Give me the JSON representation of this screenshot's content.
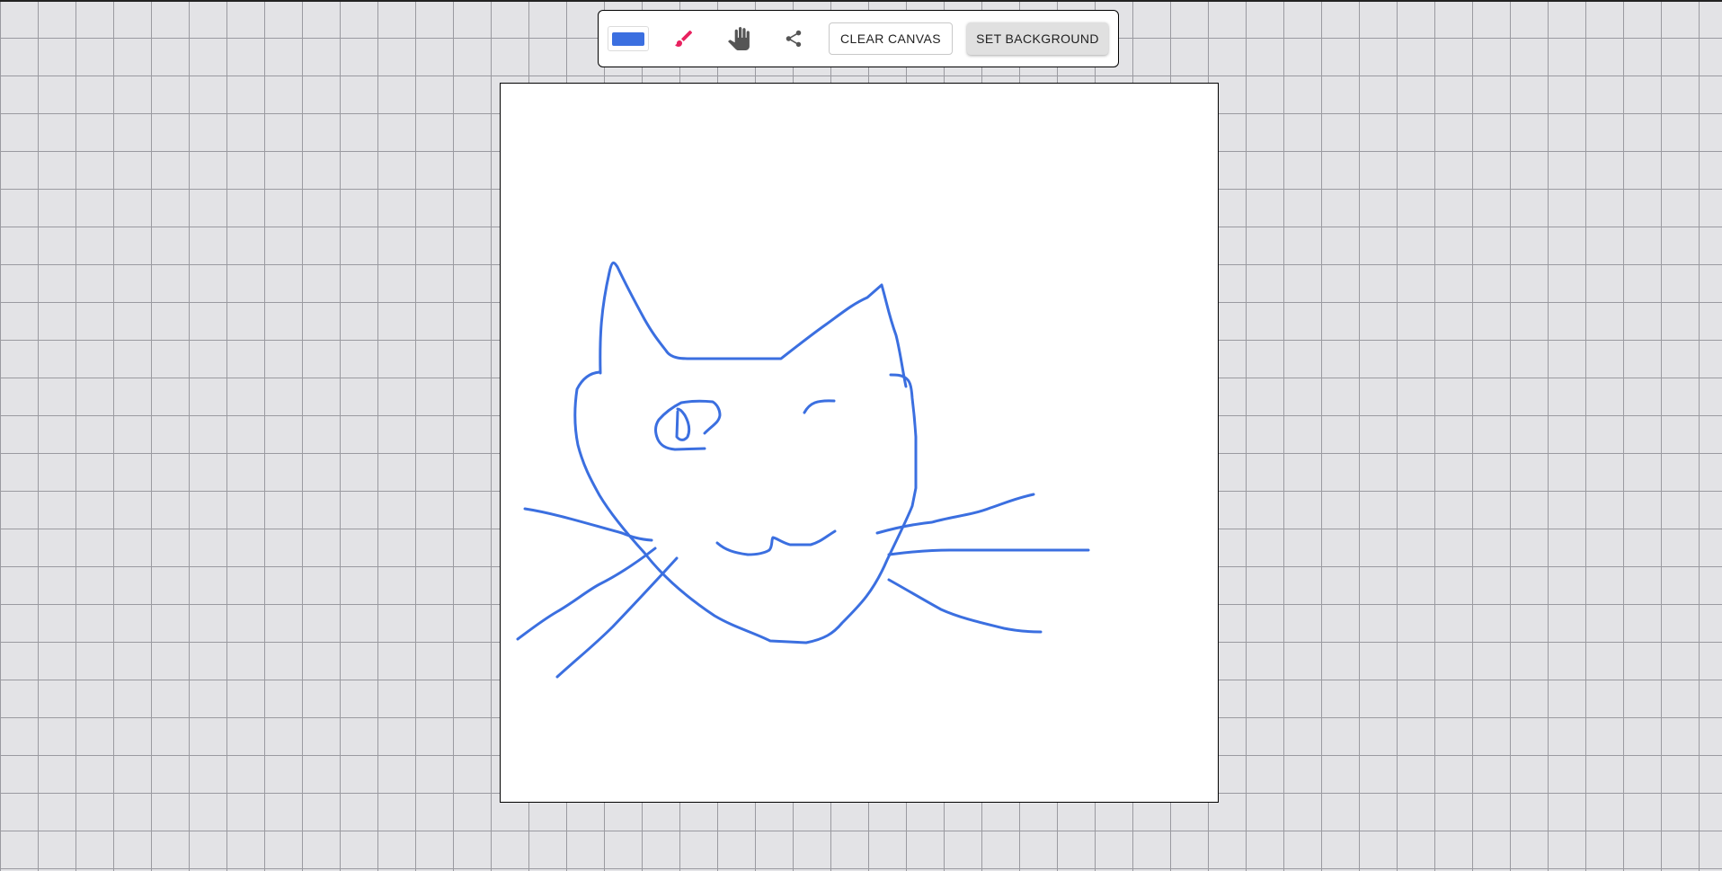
{
  "toolbar": {
    "brush_color": "#3b6fe0",
    "tools": [
      {
        "name": "brush-icon",
        "color": "#e8215f"
      },
      {
        "name": "hand-icon",
        "color": "#555555"
      },
      {
        "name": "share-icon",
        "color": "#555555"
      }
    ],
    "clear_label": "CLEAR CANVAS",
    "background_label": "SET BACKGROUND"
  },
  "canvas": {
    "background": "#ffffff",
    "drawing": {
      "description_icon": "cat-face-drawing",
      "stroke_color": "#3b6fe0"
    }
  }
}
